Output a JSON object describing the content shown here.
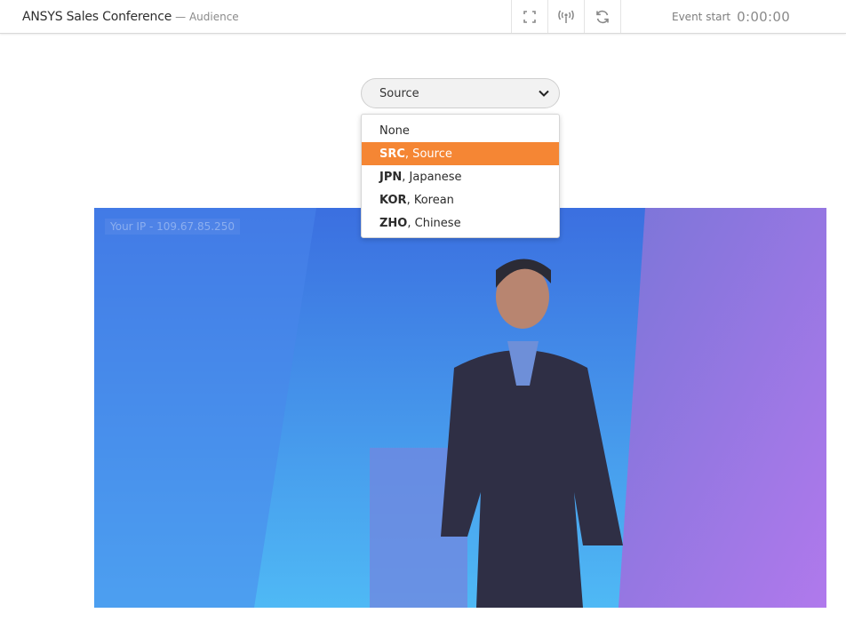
{
  "header": {
    "title": "ANSYS Sales Conference",
    "subtitle": "— Audience",
    "icons": [
      "fullscreen-icon",
      "broadcast-icon",
      "refresh-icon"
    ],
    "event_start_label": "Event start",
    "event_start_time": "0:00:00"
  },
  "source_select": {
    "value": "Source",
    "options": [
      {
        "code": "",
        "name": "None"
      },
      {
        "code": "SRC",
        "name": ", Source",
        "selected": true
      },
      {
        "code": "JPN",
        "name": ", Japanese"
      },
      {
        "code": "KOR",
        "name": ", Korean"
      },
      {
        "code": "ZHO",
        "name": ", Chinese"
      }
    ]
  },
  "video": {
    "ip_overlay": "Your IP - 109.67.85.250"
  },
  "colors": {
    "accent": "#f58634",
    "video_blue": "#3f7fe6",
    "video_purple": "#9a74e8"
  }
}
